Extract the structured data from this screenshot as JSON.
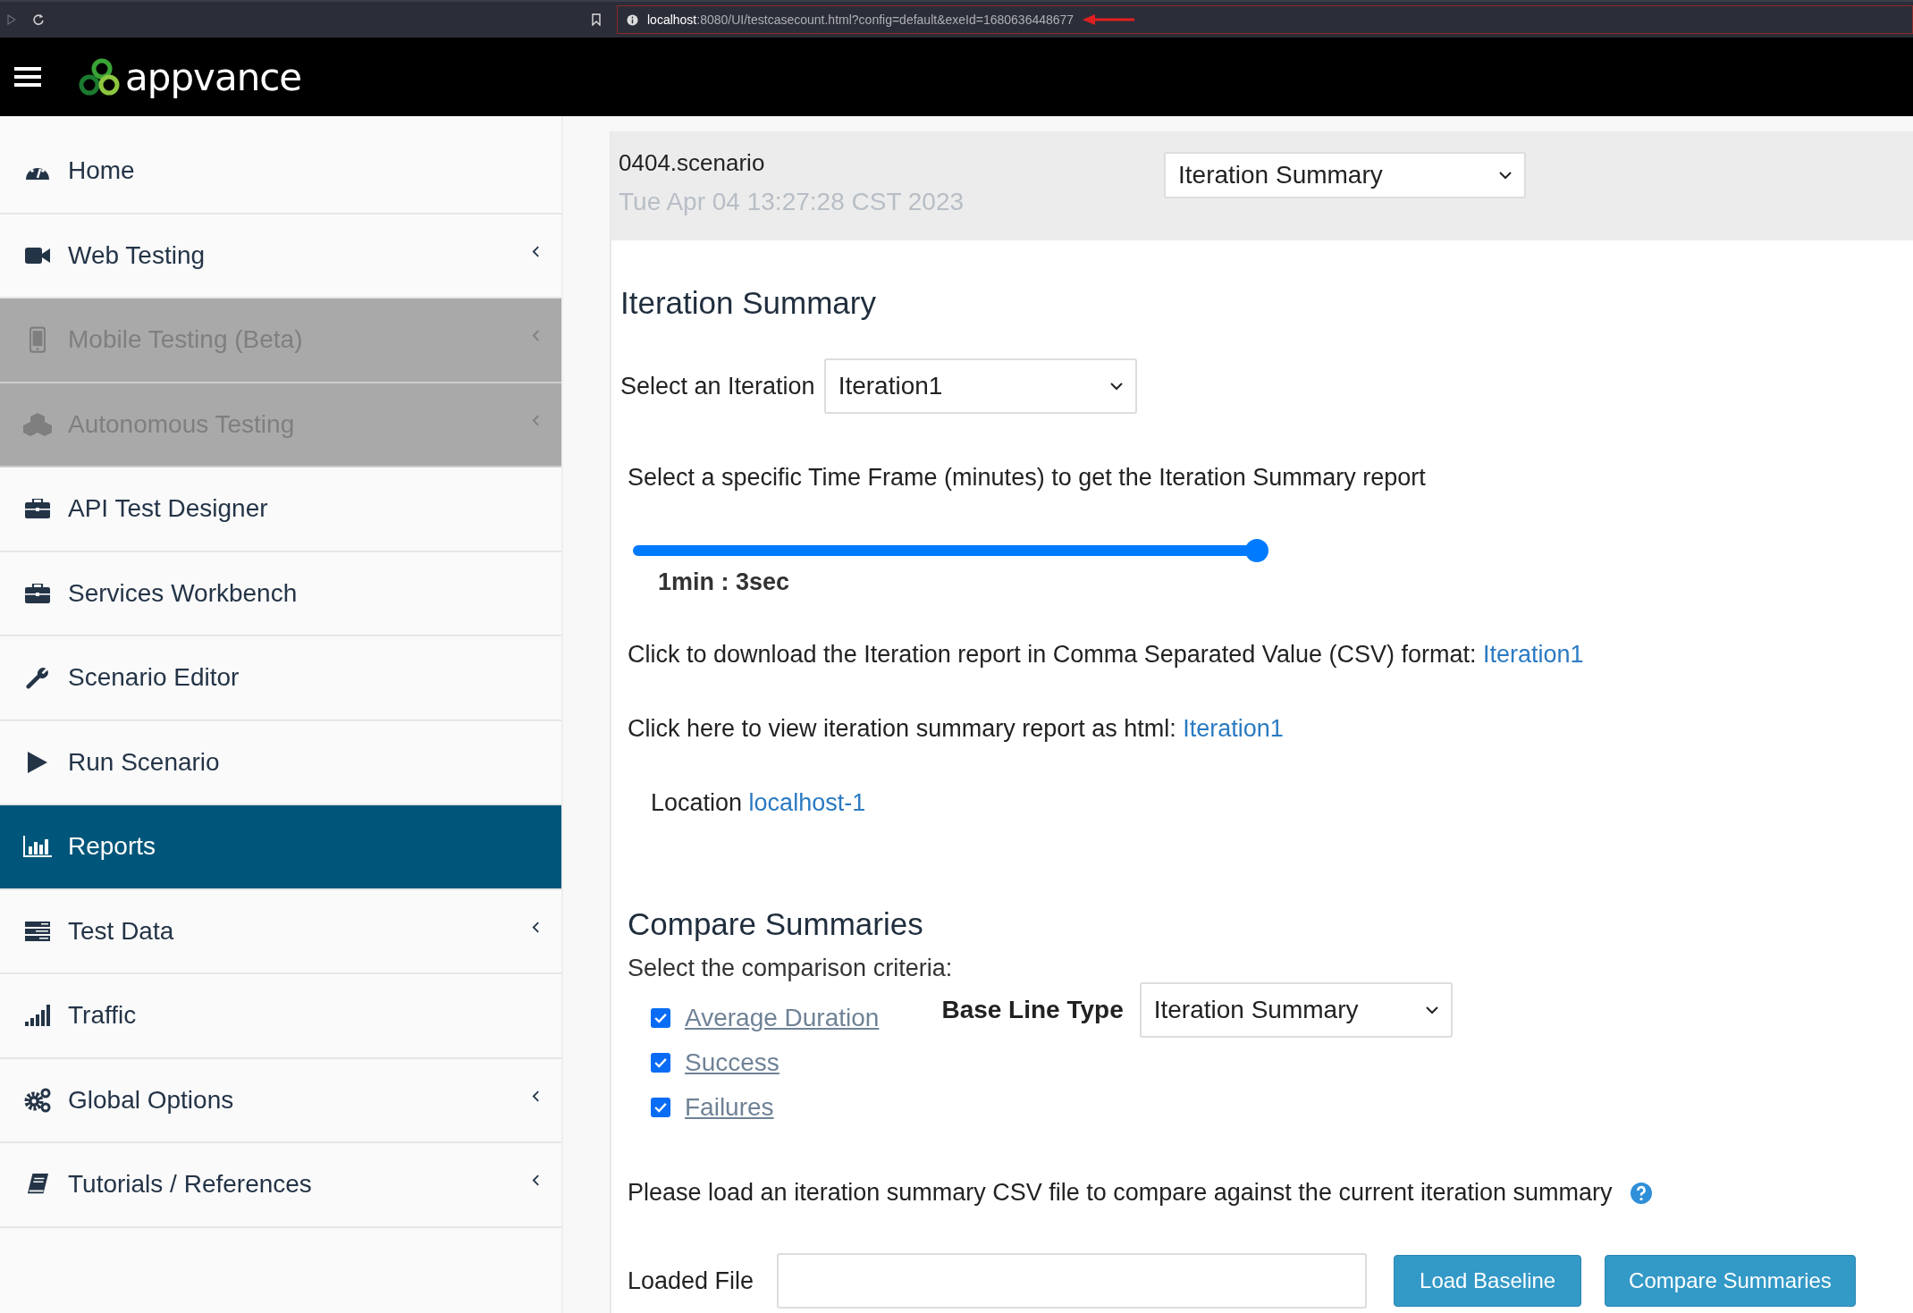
{
  "browser": {
    "url_host": "localhost",
    "url_rest": ":8080/UI/testcasecount.html?config=default&exeId=1680636448677"
  },
  "app": {
    "logo_text": "appvance"
  },
  "sidebar": {
    "items": [
      {
        "label": "Home",
        "kind": "dashboard",
        "expandable": false,
        "disabled": false,
        "selected": false
      },
      {
        "label": "Web Testing",
        "kind": "video",
        "expandable": true,
        "disabled": false,
        "selected": false
      },
      {
        "label": "Mobile Testing (Beta)",
        "kind": "mobile",
        "expandable": true,
        "disabled": true,
        "selected": false
      },
      {
        "label": "Autonomous Testing",
        "kind": "cubes",
        "expandable": true,
        "disabled": true,
        "selected": false
      },
      {
        "label": "API Test Designer",
        "kind": "briefcase",
        "expandable": false,
        "disabled": false,
        "selected": false
      },
      {
        "label": "Services Workbench",
        "kind": "briefcase",
        "expandable": false,
        "disabled": false,
        "selected": false
      },
      {
        "label": "Scenario Editor",
        "kind": "wrench",
        "expandable": false,
        "disabled": false,
        "selected": false
      },
      {
        "label": "Run Scenario",
        "kind": "play",
        "expandable": false,
        "disabled": false,
        "selected": false
      },
      {
        "label": "Reports",
        "kind": "chart",
        "expandable": false,
        "disabled": false,
        "selected": true
      },
      {
        "label": "Test Data",
        "kind": "list",
        "expandable": true,
        "disabled": false,
        "selected": false
      },
      {
        "label": "Traffic",
        "kind": "signal",
        "expandable": false,
        "disabled": false,
        "selected": false
      },
      {
        "label": "Global Options",
        "kind": "gears",
        "expandable": true,
        "disabled": false,
        "selected": false
      },
      {
        "label": "Tutorials / References",
        "kind": "book",
        "expandable": true,
        "disabled": false,
        "selected": false
      }
    ]
  },
  "report_header": {
    "scenario": "0404.scenario",
    "date": "Tue Apr 04 13:27:28 CST 2023",
    "report_type": "Iteration Summary"
  },
  "iteration_summary": {
    "title": "Iteration Summary",
    "iteration_label": "Select an Iteration",
    "iteration_value": "Iteration1",
    "timeframe_text": "Select a specific Time Frame (minutes) to get the Iteration Summary report",
    "timeframe": {
      "level": 1,
      "reading": "1min : 3sec"
    },
    "csv_text": "Click to download the Iteration report in Comma Separated Value (CSV) format:",
    "csv_link": "Iteration1",
    "html_text": "Click here to view iteration summary report as html:",
    "html_link": "Iteration1",
    "location_label": "Location",
    "location_link": "localhost-1"
  },
  "compare": {
    "title": "Compare Summaries",
    "criteria_label": "Select the comparison criteria:",
    "criteria": [
      {
        "label": "Average Duration",
        "checked": true
      },
      {
        "label": "Success",
        "checked": true
      },
      {
        "label": "Failures",
        "checked": true
      }
    ],
    "baseline_label": "Base Line Type",
    "baseline_value": "Iteration Summary",
    "load_text": "Please load an iteration summary CSV file to compare against the current iteration summary",
    "file_label": "Loaded File",
    "buttons": [
      "Load Baseline",
      "Compare Summaries"
    ]
  }
}
